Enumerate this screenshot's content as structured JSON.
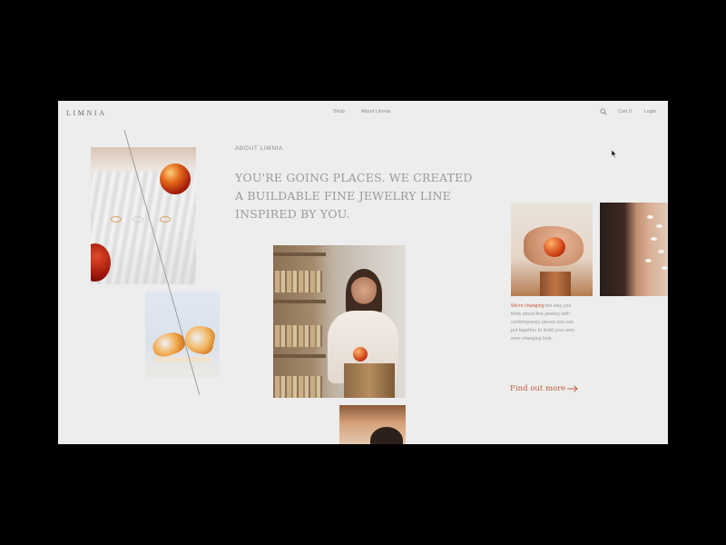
{
  "nav": {
    "logo": "LIMNIA",
    "links": [
      "Shop",
      "About Limnia"
    ],
    "cart": "Cart 0",
    "login": "Login"
  },
  "hero": {
    "eyebrow": "ABOUT LIMNIA",
    "headline_lines": [
      "YOU'RE GOING PLACES. WE CREATED",
      "A BUILDABLE FINE JEWELRY LINE",
      "INSPIRED BY YOU."
    ]
  },
  "copy": {
    "lead": "We're changing",
    "lines": [
      " the way you",
      "think about fine jewelry with",
      "contemporary pieces you can",
      "put together to build your own",
      "ever-changing look."
    ]
  },
  "cta": {
    "label": "Find out more"
  },
  "colors": {
    "page_bg": "#ededed",
    "accent": "#bf5e3f",
    "text_muted": "#9a9a9a"
  },
  "icons": [
    "search-icon",
    "arrow-right-icon",
    "cursor-icon"
  ]
}
